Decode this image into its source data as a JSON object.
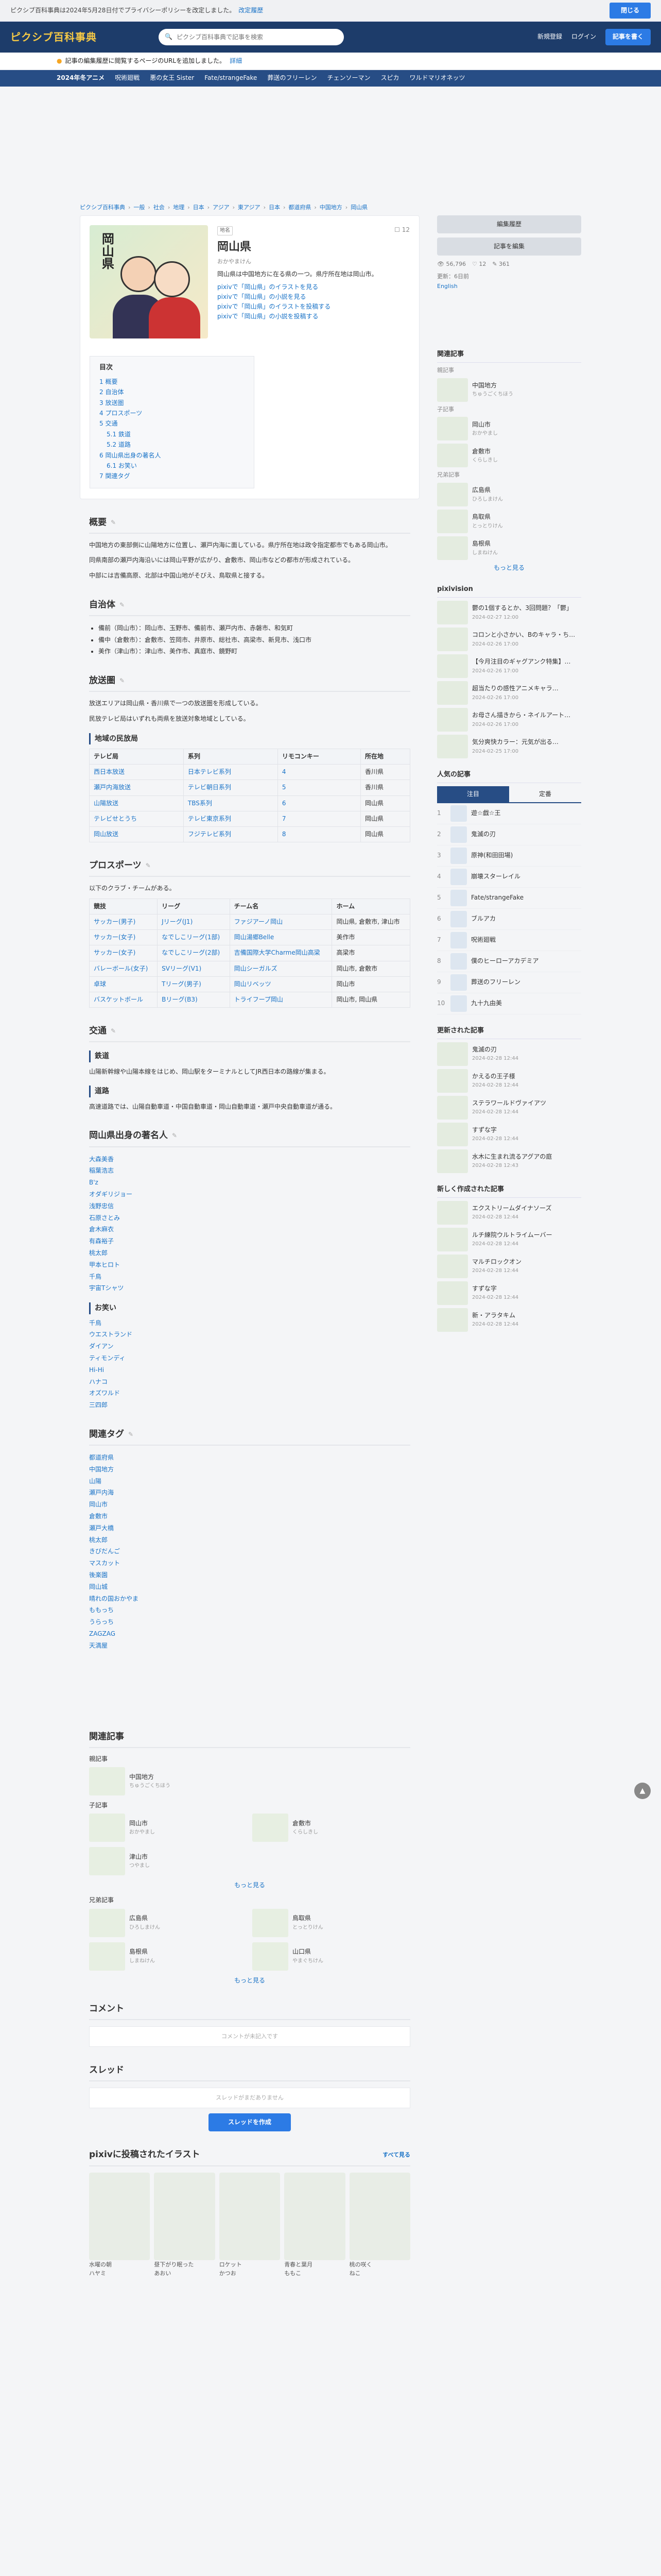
{
  "topbar": {
    "message": "ピクシブ百科事典は2024年5月28日付でプライバシーポリシーを改定しました。",
    "policy_link": "改定履歴",
    "close": "閉じる"
  },
  "header": {
    "logo_main": "ピクシブ",
    "logo_accent": "百科事典",
    "search_placeholder": "ピクシブ百科事典で記事を検索",
    "register": "新規登録",
    "login": "ログイン",
    "create": "記事を書く"
  },
  "notice": {
    "text": "記事の編集履歴に閲覧するページのURLを追加しました。",
    "link": "詳細"
  },
  "trend": {
    "label": "2024年冬アニメ",
    "items": [
      "呪術廻戦",
      "悪の女王 Sister",
      "Fate/strangeFake",
      "葬送のフリーレン",
      "チェンソーマン",
      "スピカ",
      "ワルドマリオネッツ"
    ]
  },
  "breadcrumb": [
    "ピクシブ百科事典",
    "一般",
    "社会",
    "地理",
    "日本",
    "アジア",
    "東アジア",
    "日本",
    "都道府県",
    "中国地方",
    "岡山県"
  ],
  "article": {
    "tag": "地名",
    "title": "岡山県",
    "reading": "おかやまけん",
    "summary": "岡山県は中国地方に在る県の一つ。県庁所在地は岡山市。",
    "bookmark_count": "12",
    "links": [
      "pixivで「岡山県」のイラストを見る",
      "pixivで「岡山県」の小説を見る",
      "pixivで「岡山県」のイラストを投稿する",
      "pixivで「岡山県」の小説を投稿する"
    ],
    "thumb_text": "岡山県"
  },
  "toc": {
    "title": "目次",
    "items": [
      {
        "t": "1 概要",
        "lv": 1
      },
      {
        "t": "2 自治体",
        "lv": 1
      },
      {
        "t": "3 放送圏",
        "lv": 1
      },
      {
        "t": "4 プロスポーツ",
        "lv": 1
      },
      {
        "t": "5 交通",
        "lv": 1
      },
      {
        "t": "5.1 鉄道",
        "lv": 2
      },
      {
        "t": "5.2 道路",
        "lv": 2
      },
      {
        "t": "6 岡山県出身の著名人",
        "lv": 1
      },
      {
        "t": "6.1 お笑い",
        "lv": 2
      },
      {
        "t": "7 関連タグ",
        "lv": 1
      }
    ]
  },
  "sections": {
    "gaiyo": {
      "title": "概要",
      "paras": [
        "中国地方の東部側に山陽地方に位置し、瀬戸内海に面している。県庁所在地は政令指定都市でもある岡山市。",
        "同県南部の瀬戸内海沿いには岡山平野が広がり、倉敷市、岡山市などの都市が形成されている。",
        "中部には吉備高原、北部は中国山地がそびえ、鳥取県と接する。"
      ]
    },
    "jichitai": {
      "title": "自治体",
      "items": [
        "備前（岡山市）：岡山市、玉野市、備前市、瀬戸内市、赤磐市、和気町",
        "備中（倉敷市）：倉敷市、笠岡市、井原市、総社市、高梁市、新見市、浅口市",
        "美作（津山市）：津山市、美作市、真庭市、鏡野町"
      ]
    },
    "hoso": {
      "title": "放送圏",
      "paras": [
        "放送エリアは岡山県・香川県で一つの放送圏を形成している。",
        "民放テレビ局はいずれも両県を放送対象地域としている。"
      ],
      "table_title": "地域の民放局",
      "table_head": [
        "テレビ局",
        "系列",
        "リモコンキー",
        "所在地"
      ],
      "table_rows": [
        [
          "西日本放送",
          "日本テレビ系列",
          "4",
          "香川県"
        ],
        [
          "瀬戸内海放送",
          "テレビ朝日系列",
          "5",
          "香川県"
        ],
        [
          "山陽放送",
          "TBS系列",
          "6",
          "岡山県"
        ],
        [
          "テレビせとうち",
          "テレビ東京系列",
          "7",
          "岡山県"
        ],
        [
          "岡山放送",
          "フジテレビ系列",
          "8",
          "岡山県"
        ]
      ]
    },
    "sports": {
      "title": "プロスポーツ",
      "note": "以下のクラブ・チームがある。",
      "head": [
        "競技",
        "リーグ",
        "チーム名",
        "ホーム"
      ],
      "rows": [
        [
          "サッカー(男子)",
          "Jリーグ(J1)",
          "ファジアーノ岡山",
          "岡山県, 倉敷市, 津山市"
        ],
        [
          "サッカー(女子)",
          "なでしこリーグ(1部)",
          "岡山湯郷Belle",
          "美作市"
        ],
        [
          "サッカー(女子)",
          "なでしこリーグ(2部)",
          "吉備国際大学Charme岡山高梁",
          "高梁市"
        ],
        [
          "バレーボール(女子)",
          "SVリーグ(V1)",
          "岡山シーガルズ",
          "岡山市, 倉敷市"
        ],
        [
          "卓球",
          "Tリーグ(男子)",
          "岡山リベッツ",
          "岡山市"
        ],
        [
          "バスケットボール",
          "Bリーグ(B3)",
          "トライフープ岡山",
          "岡山市, 岡山県"
        ]
      ]
    },
    "kotsu": {
      "title": "交通",
      "rail_title": "鉄道",
      "rail": "山陽新幹線や山陽本線をはじめ、岡山駅をターミナルとしてJR西日本の路線が集まる。",
      "road_title": "道路",
      "road": "高速道路では、山陽自動車道・中国自動車道・岡山自動車道・瀬戸中央自動車道が通る。"
    },
    "famous": {
      "title": "岡山県出身の著名人",
      "names": [
        "大森美香",
        "稲葉浩志",
        "B'z",
        "オダギリジョー",
        "浅野忠信",
        "石原さとみ",
        "倉木麻衣",
        "有森裕子",
        "桃太郎",
        "甲本ヒロト",
        "千鳥",
        "宇宙Tシャツ"
      ],
      "owarai_title": "お笑い",
      "owarai": [
        "千鳥",
        "ウエストランド",
        "ダイアン",
        "ティモンディ",
        "Hi-Hi",
        "ハナコ",
        "オズワルド",
        "三四郎"
      ]
    },
    "tags": {
      "title": "関連タグ",
      "items": [
        "都道府県",
        "中国地方",
        "山陽",
        "瀬戸内海",
        "岡山市",
        "倉敷市",
        "瀬戸大橋",
        "桃太郎",
        "きびだんご",
        "マスカット",
        "後楽園",
        "岡山城",
        "晴れの国おかやま",
        "ももっち",
        "うらっち",
        "ZAGZAG",
        "天満屋"
      ]
    }
  },
  "related": {
    "title": "関連記事",
    "group1_title": "親記事",
    "group2_title": "子記事",
    "group3_title": "兄弟記事",
    "items": [
      {
        "name": "中国地方",
        "sub": "ちゅうごくちほう"
      },
      {
        "name": "岡山市",
        "sub": "おかやまし"
      },
      {
        "name": "倉敷市",
        "sub": "くらしきし"
      },
      {
        "name": "津山市",
        "sub": "つやまし"
      },
      {
        "name": "広島県",
        "sub": "ひろしまけん"
      },
      {
        "name": "鳥取県",
        "sub": "とっとりけん"
      },
      {
        "name": "島根県",
        "sub": "しまねけん"
      },
      {
        "name": "山口県",
        "sub": "やまぐちけん"
      }
    ],
    "more": "もっと見る"
  },
  "comment": {
    "title": "コメント",
    "placeholder": "コメントが未記入です"
  },
  "thread": {
    "title": "スレッド",
    "empty": "スレッドがまだありません",
    "button": "スレッドを作成"
  },
  "pixiv": {
    "title": "pixivに投稿されたイラスト",
    "more": "すべて見る",
    "items": [
      {
        "t": "水曜の朝",
        "u": "ハヤミ"
      },
      {
        "t": "昼下がり眠った",
        "u": "あおい"
      },
      {
        "t": "ロケット",
        "u": "かつお"
      },
      {
        "t": "青春と葉月",
        "u": "ももこ"
      },
      {
        "t": "桃の咲く",
        "u": "ねこ"
      }
    ]
  },
  "sidebar": {
    "edit_btn": "編集履歴",
    "edit2_btn": "記事を編集",
    "stats": {
      "views": "56,796",
      "likes": "12",
      "edits": "361"
    },
    "updated": "更新：6日前",
    "lang": "English",
    "related_title": "関連記事",
    "related_groups": [
      {
        "title": "親記事",
        "items": [
          {
            "name": "中国地方",
            "sub": "ちゅうごくちほう"
          }
        ]
      },
      {
        "title": "子記事",
        "items": [
          {
            "name": "岡山市",
            "sub": "おかやまし"
          },
          {
            "name": "倉敷市",
            "sub": "くらしきし"
          }
        ]
      },
      {
        "title": "兄弟記事",
        "items": [
          {
            "name": "広島県",
            "sub": "ひろしまけん"
          },
          {
            "name": "鳥取県",
            "sub": "とっとりけん"
          },
          {
            "name": "島根県",
            "sub": "しまねけん"
          }
        ]
      }
    ],
    "more": "もっと見る",
    "pixivision_title": "pixivision",
    "pixivision": [
      {
        "t": "鬱の1個するとか、3回問題？「鬱」",
        "d": "2024-02-27 12:00"
      },
      {
        "t": "コロンと小さかい、Bのキャラ・ち…",
        "d": "2024-02-26 17:00"
      },
      {
        "t": "【今月注目のギャグアンク特集】…",
        "d": "2024-02-26 17:00"
      },
      {
        "t": "超当たりの感性アニメキャラ…",
        "d": "2024-02-26 17:00"
      },
      {
        "t": "お母さん描きから・ネイルアート…",
        "d": "2024-02-26 17:00"
      },
      {
        "t": "気分爽快カラー：元気が出る…",
        "d": "2024-02-25 17:00"
      }
    ],
    "popular_title": "人気の記事",
    "popular_tabs": [
      "注目",
      "定番"
    ],
    "popular": [
      "遊☆戯☆王",
      "鬼滅の刃",
      "原神(和田田場)",
      "崩壊スターレイル",
      "Fate/strangeFake",
      "ブルアカ",
      "呪術廻戦",
      "僕のヒーローアカデミア",
      "葬送のフリーレン",
      "九十九由美"
    ],
    "updated_title": "更新された記事",
    "updated_items": [
      {
        "t": "鬼滅の刃",
        "d": "2024-02-28 12:44"
      },
      {
        "t": "かえるの王子様",
        "d": "2024-02-28 12:44"
      },
      {
        "t": "ステラワールドヴァイアツ",
        "d": "2024-02-28 12:44"
      },
      {
        "t": "すずな字",
        "d": "2024-02-28 12:44"
      },
      {
        "t": "水木に生まれ流るアグアの庭",
        "d": "2024-02-28 12:43"
      }
    ],
    "new_title": "新しく作成された記事",
    "new_items": [
      {
        "t": "エクストリームダイナソーズ",
        "d": "2024-02-28 12:44"
      },
      {
        "t": "ルチ練院ウルトライムーバー",
        "d": "2024-02-28 12:44"
      },
      {
        "t": "マルチロックオン",
        "d": "2024-02-28 12:44"
      },
      {
        "t": "すずな字",
        "d": "2024-02-28 12:44"
      },
      {
        "t": "新・アラタキム",
        "d": "2024-02-28 12:44"
      }
    ]
  }
}
